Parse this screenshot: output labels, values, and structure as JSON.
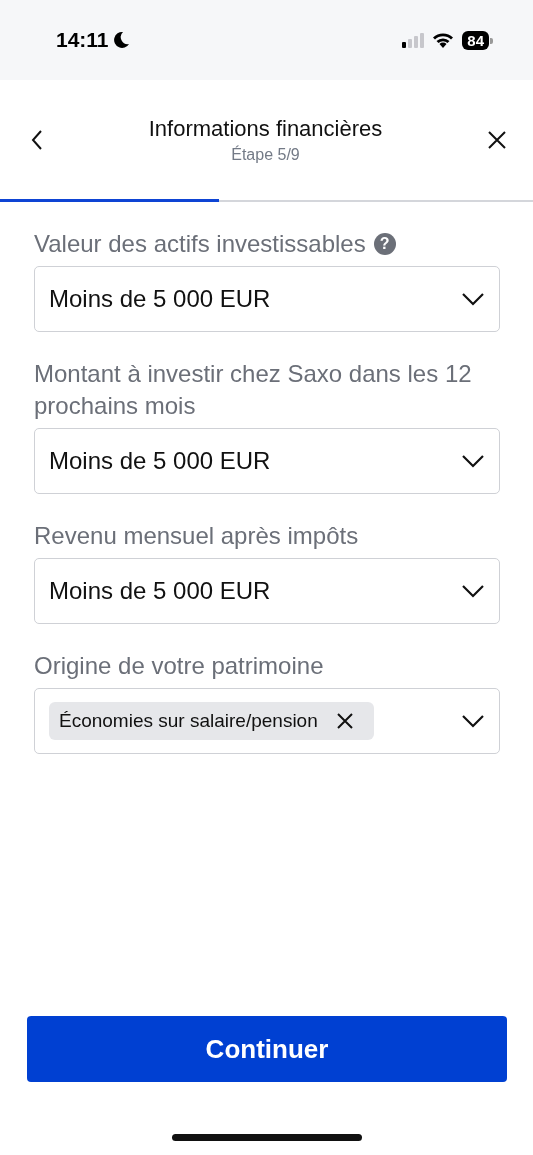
{
  "status_bar": {
    "time": "14:11",
    "do_not_disturb": true,
    "battery": "84"
  },
  "header": {
    "title": "Informations financières",
    "subtitle": "Étape 5/9"
  },
  "progress": {
    "level": 0.41
  },
  "fields": [
    {
      "kind": "select",
      "label": "Valeur des actifs investissables",
      "help": "?",
      "value": "Moins de 5 000 EUR"
    },
    {
      "kind": "select",
      "label": "Montant à investir chez Saxo dans les 12 prochains mois",
      "value": "Moins de 5 000 EUR"
    },
    {
      "kind": "select",
      "label": "Revenu mensuel après impôts",
      "value": "Moins de 5 000 EUR"
    },
    {
      "kind": "multiselect",
      "label": "Origine de votre patrimoine",
      "chips": [
        "Économies sur salaire/pension"
      ]
    }
  ],
  "primary_button": "Continuer"
}
